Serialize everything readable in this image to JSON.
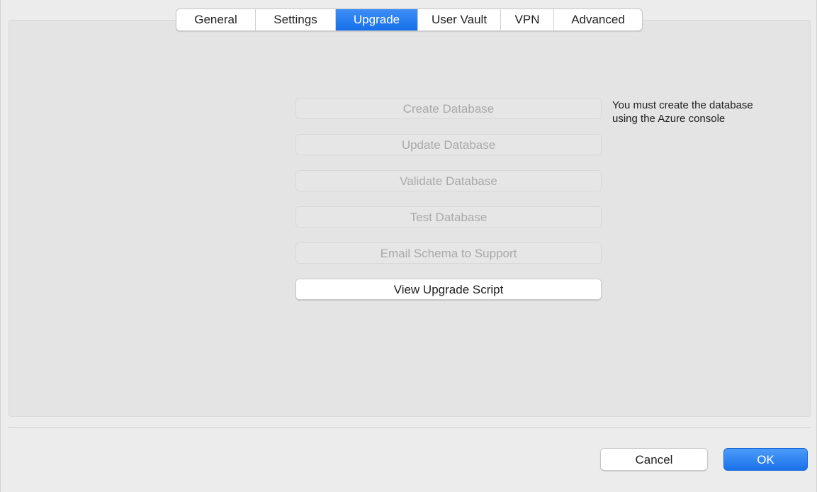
{
  "tabs": {
    "general": "General",
    "settings": "Settings",
    "upgrade": "Upgrade",
    "user_vault": "User Vault",
    "vpn": "VPN",
    "advanced": "Advanced",
    "active": "Upgrade"
  },
  "actions": {
    "create_database": "Create Database",
    "update_database": "Update Database",
    "validate_database": "Validate Database",
    "test_database": "Test Database",
    "email_schema": "Email Schema to Support",
    "view_upgrade_script": "View Upgrade Script"
  },
  "note": {
    "line1": "You must create the database",
    "line2": "using the Azure console"
  },
  "footer": {
    "cancel": "Cancel",
    "ok": "OK"
  },
  "colors": {
    "accent": "#1670e9",
    "disabled_text": "#a9a9a9"
  }
}
